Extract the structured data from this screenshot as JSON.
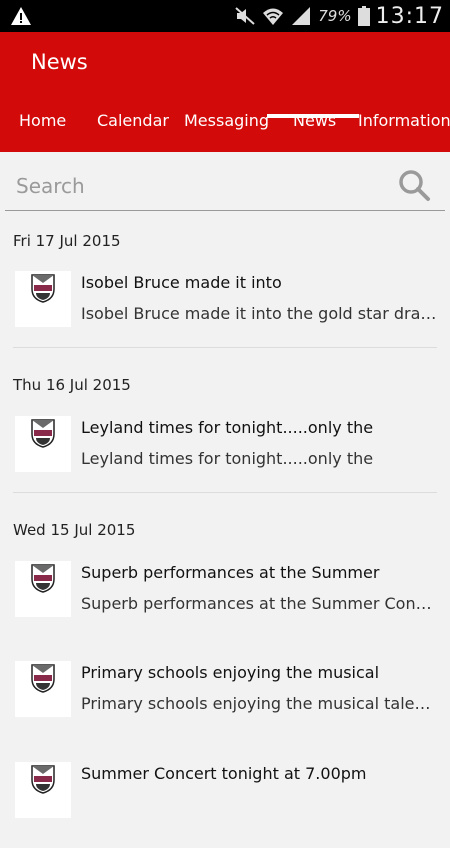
{
  "status_bar": {
    "battery_percent": "79%",
    "time": "13:17",
    "icons": [
      "warning-icon",
      "mute-icon",
      "wifi-icon",
      "signal-icon",
      "battery-icon"
    ]
  },
  "app_bar": {
    "title": "News",
    "color": "#d30a0a"
  },
  "tabs": [
    {
      "label": "Home"
    },
    {
      "label": "Calendar"
    },
    {
      "label": "Messaging"
    },
    {
      "label": "News",
      "selected": true
    },
    {
      "label": "Information"
    }
  ],
  "search": {
    "placeholder": "Search"
  },
  "news_groups": [
    {
      "date": "Fri 17 Jul 2015",
      "items": [
        {
          "title": "Isobel Bruce made it into",
          "summary": "Isobel Bruce made it into the gold star draw this week"
        }
      ]
    },
    {
      "date": "Thu 16 Jul 2015",
      "items": [
        {
          "title": "Leyland times for tonight.....only the",
          "summary": "Leyland times for tonight.....only the"
        }
      ]
    },
    {
      "date": "Wed 15 Jul 2015",
      "items": [
        {
          "title": "Superb performances at the Summer",
          "summary": "Superb performances at the Summer Concert last night"
        },
        {
          "title": "Primary schools enjoying the musical",
          "summary": "Primary schools enjoying the musical talent of our pupils"
        },
        {
          "title": "Summer Concert tonight at 7.00pm",
          "summary": ""
        }
      ]
    }
  ]
}
